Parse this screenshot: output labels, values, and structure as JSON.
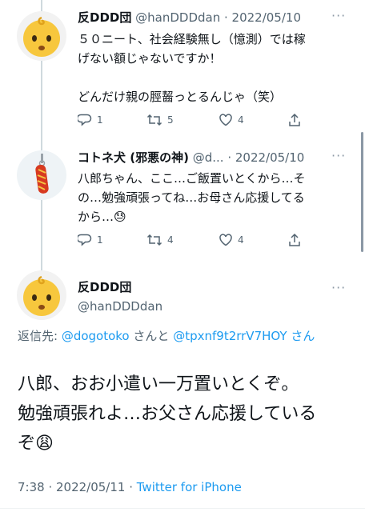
{
  "tweets": [
    {
      "name": "反DDD団",
      "handle": "@hanDDDdan",
      "date": "· 2022/05/10",
      "lines": [
        "５０ニート、社会経験無し（憶測）では稼",
        "げない額じゃないですか！",
        "",
        "どんだけ親の脛齧っとるんじゃ（笑）"
      ],
      "replies": "1",
      "retweets": "5",
      "likes": "4"
    },
    {
      "name": "コトネ犬 (邪悪の神)",
      "handle": "@d...",
      "date": "· 2022/05/10",
      "lines": [
        "八郎ちゃん、ここ…ご飯置いとくから…そ",
        "の…勉強頑張ってね…お母さん応援してる",
        "から…😓"
      ],
      "replies": "1",
      "retweets": "4",
      "likes": "4"
    }
  ],
  "main_tweet": {
    "name": "反DDD団",
    "handle": "@hanDDDdan",
    "reply_prefix": "返信先: ",
    "reply_user1": "@dogotoko",
    "reply_and": "さんと",
    "reply_user2": "@tpxnf9t2rrV7HOY",
    "reply_san": "さん",
    "lines": [
      "八郎、おお小遣い一万置いとくぞ。",
      "勉強頑張れよ…お父さん応援している",
      "ぞ😩"
    ],
    "time": "7:38 · 2022/05/11 · ",
    "source": "Twitter for iPhone"
  },
  "more_label": "···",
  "colors": {
    "accent": "#1d9bf0",
    "meta": "#536471",
    "line": "#cfd9de"
  }
}
